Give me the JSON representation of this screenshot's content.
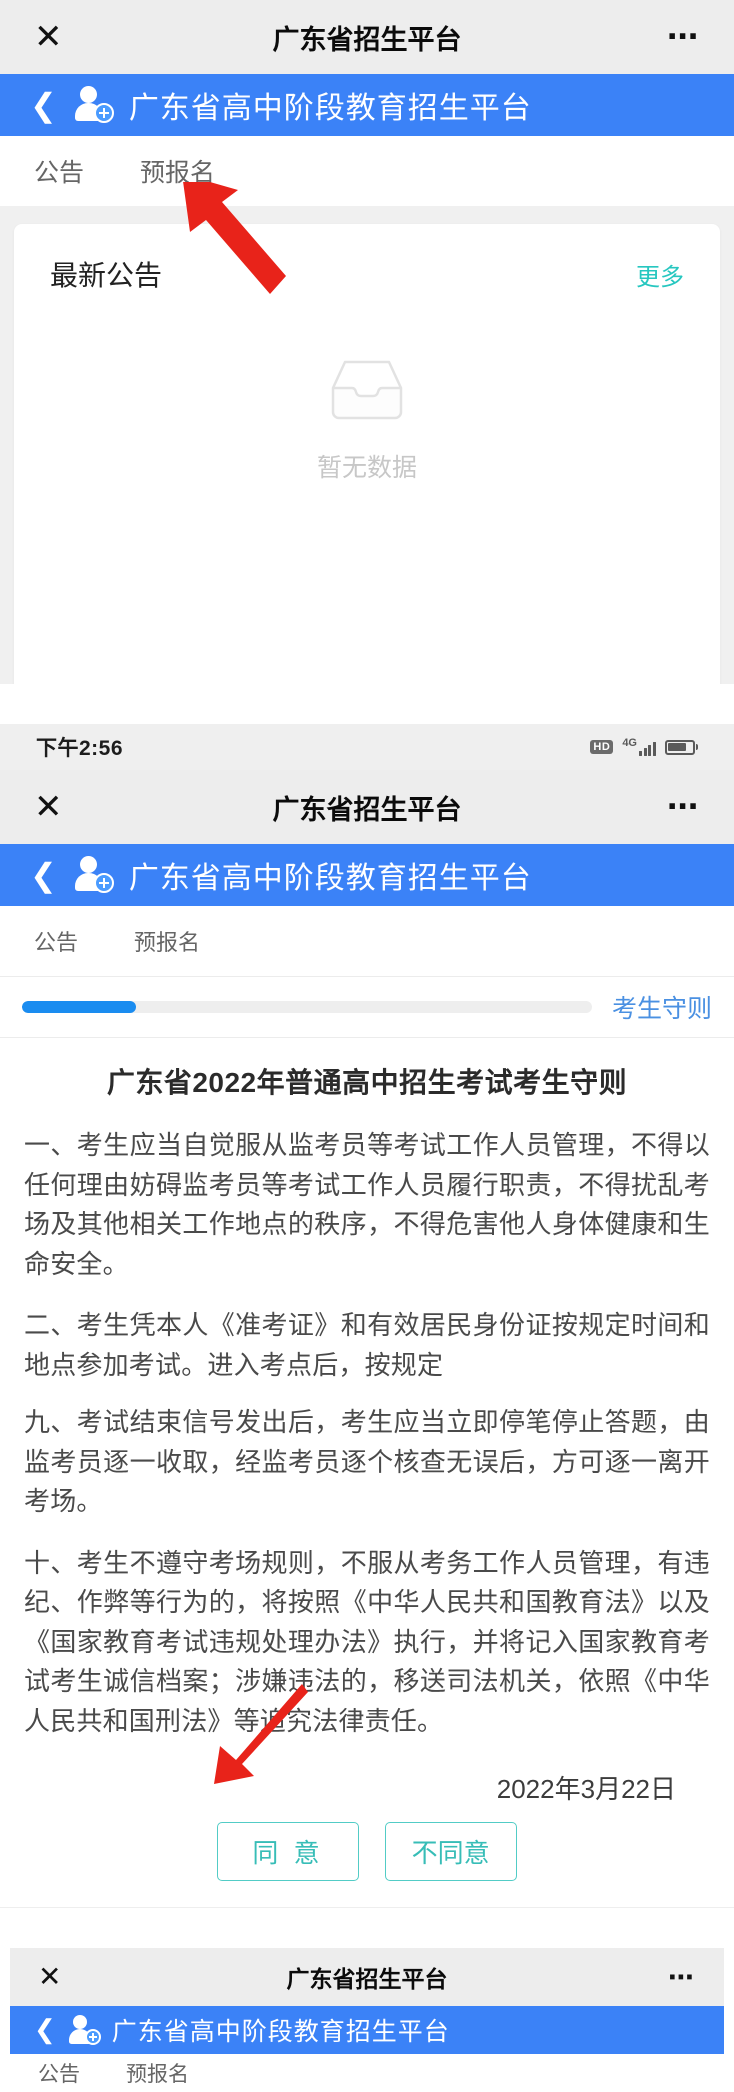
{
  "wechat_bar": {
    "close_icon": "close-icon",
    "title": "广东省招生平台",
    "more_icon": "more-dots-icon"
  },
  "app_header": {
    "back_icon": "chevron-left-icon",
    "logo_icon": "user-add-icon",
    "title": "广东省高中阶段教育招生平台",
    "background_color": "#3b82f7"
  },
  "tabs": [
    {
      "label": "公告",
      "active": true
    },
    {
      "label": "预报名",
      "active": false
    }
  ],
  "screen1": {
    "card": {
      "title": "最新公告",
      "more_label": "更多",
      "more_color": "#27c7c0",
      "empty": {
        "icon": "empty-inbox-icon",
        "text": "暂无数据"
      }
    }
  },
  "screen2": {
    "status_bar": {
      "time": "下午2:56",
      "hd_label": "HD",
      "network_label": "4G",
      "signal_icon": "signal-bars-icon",
      "battery_icon": "battery-icon"
    },
    "progress": {
      "percent": 20,
      "fill_color": "#1a8cf0",
      "track_color": "#eeeeee",
      "link_label": "考生守则",
      "link_color": "#4a90e2"
    },
    "document": {
      "title": "广东省2022年普通高中招生考试考生守则",
      "paragraphs": [
        "一、考生应当自觉服从监考员等考试工作人员管理，不得以任何理由妨碍监考员等考试工作人员履行职责，不得扰乱考场及其他相关工作地点的秩序，不得危害他人身体健康和生命安全。",
        "二、考生凭本人《准考证》和有效居民身份证按规定时间和地点参加考试。进入考点后，按规定",
        "九、考试结束信号发出后，考生应当立即停笔停止答题，由监考员逐一收取，经监考员逐个核查无误后，方可逐一离开考场。",
        "十、考生不遵守考场规则，不服从考务工作人员管理，有违纪、作弊等行为的，将按照《中华人民共和国教育法》以及《国家教育考试违规处理办法》执行，并将记入国家教育考试考生诚信档案；涉嫌违法的，移送司法机关，依照《中华人民共和国刑法》等追究法律责任。"
      ],
      "date": "2022年3月22日"
    },
    "actions": {
      "agree_label": "同 意",
      "disagree_label": "不同意",
      "border_color": "#52ccc6",
      "text_color": "#37bdb7"
    },
    "android_nav": {
      "menu_icon": "menu-icon",
      "home_icon": "home-square-icon",
      "back_icon": "back-chevron-icon"
    }
  },
  "annotations": {
    "arrow1": "red-arrow-pointing-to-preregister-tab",
    "arrow2": "red-arrow-pointing-to-agree-button",
    "color": "#e8231a"
  }
}
